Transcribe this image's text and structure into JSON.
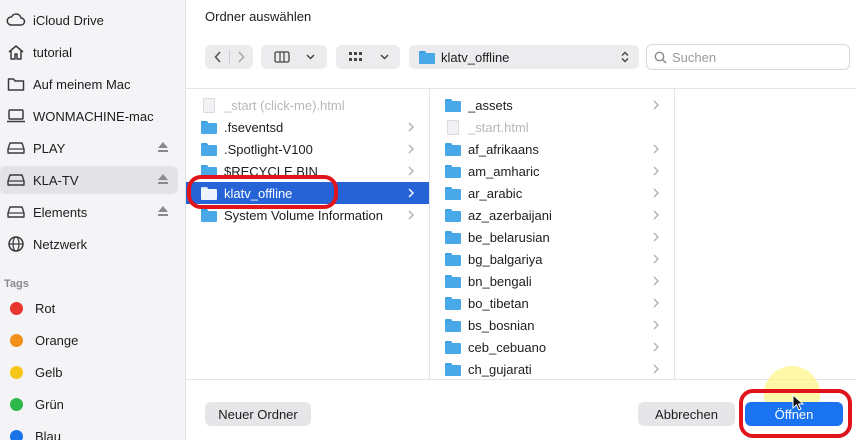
{
  "dialog": {
    "title": "Ordner auswählen"
  },
  "sidebar": {
    "items": [
      {
        "label": "iCloud Drive",
        "icon": "cloud-icon"
      },
      {
        "label": "tutorial",
        "icon": "home-icon"
      },
      {
        "label": "Auf meinem Mac",
        "icon": "folder-outline-icon"
      },
      {
        "label": "WONMACHINE-mac",
        "icon": "laptop-icon"
      },
      {
        "label": "PLAY",
        "icon": "disk-icon",
        "eject": true
      },
      {
        "label": "KLA-TV",
        "icon": "disk-icon",
        "eject": true,
        "selected": true
      },
      {
        "label": "Elements",
        "icon": "disk-icon",
        "eject": true
      },
      {
        "label": "Netzwerk",
        "icon": "globe-icon"
      }
    ],
    "tags_title": "Tags",
    "tags": [
      {
        "label": "Rot",
        "color": "#e8362e"
      },
      {
        "label": "Orange",
        "color": "#f2901c"
      },
      {
        "label": "Gelb",
        "color": "#f5c518"
      },
      {
        "label": "Grün",
        "color": "#2eb84b"
      },
      {
        "label": "Blau",
        "color": "#1a73e8"
      }
    ]
  },
  "toolbar": {
    "path_label": "klatv_offline",
    "search_placeholder": "Suchen"
  },
  "columns": {
    "col1": [
      {
        "name": "_start (click-me).html",
        "type": "file",
        "dim": true
      },
      {
        "name": ".fseventsd",
        "type": "folder"
      },
      {
        "name": ".Spotlight-V100",
        "type": "folder"
      },
      {
        "name": "$RECYCLE.BIN",
        "type": "folder"
      },
      {
        "name": "klatv_offline",
        "type": "folder",
        "selected": true
      },
      {
        "name": "System Volume Information",
        "type": "folder"
      }
    ],
    "col2": [
      {
        "name": "_assets",
        "type": "folder"
      },
      {
        "name": "_start.html",
        "type": "file",
        "dim": true
      },
      {
        "name": "af_afrikaans",
        "type": "folder"
      },
      {
        "name": "am_amharic",
        "type": "folder"
      },
      {
        "name": "ar_arabic",
        "type": "folder"
      },
      {
        "name": "az_azerbaijani",
        "type": "folder"
      },
      {
        "name": "be_belarusian",
        "type": "folder"
      },
      {
        "name": "bg_balgariya",
        "type": "folder"
      },
      {
        "name": "bn_bengali",
        "type": "folder"
      },
      {
        "name": "bo_tibetan",
        "type": "folder"
      },
      {
        "name": "bs_bosnian",
        "type": "folder"
      },
      {
        "name": "ceb_cebuano",
        "type": "folder"
      },
      {
        "name": "ch_gujarati",
        "type": "folder"
      }
    ]
  },
  "footer": {
    "new_folder_label": "Neuer Ordner",
    "cancel_label": "Abbrechen",
    "open_label": "Öffnen"
  },
  "colors": {
    "accent": "#1a73f0",
    "selection": "#2563d6",
    "annotation": "#e0141a"
  }
}
